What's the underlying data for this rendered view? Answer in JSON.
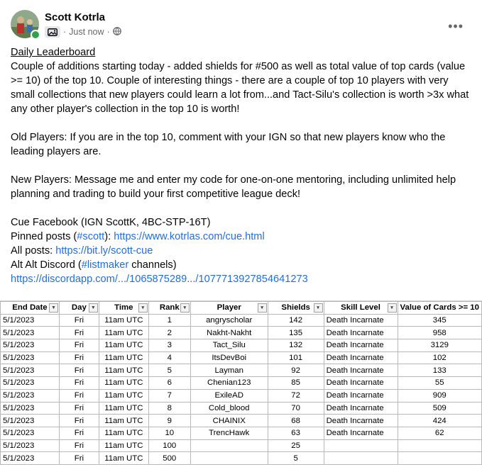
{
  "post": {
    "author": "Scott Kotrla",
    "timestamp": "Just now",
    "separator": "·",
    "audience_icon": "globe-icon",
    "badge_icon": "image-icon",
    "more_icon": "more-options-icon",
    "more_label": "•••"
  },
  "body": {
    "heading": "Daily Leaderboard",
    "para1": "Couple of additions starting today - added shields for #500 as well as total value of top cards (value >= 10) of the top 10. Couple of interesting things - there are a couple of top 10 players with very small collections that new players could learn a lot from...and Tact-Silu's collection is worth >3x what any other player's collection in the top 10 is worth!",
    "para2": "Old Players: If you are in the top 10, comment with your IGN so that new players know who the leading players are.",
    "para3": "New Players: Message me and enter my code for one-on-one mentoring, including unlimited help planning and trading to build your first competitive league deck!",
    "line_cue_facebook": "Cue Facebook (IGN ScottK, 4BC-STP-16T)",
    "pinned_prefix": "Pinned posts (",
    "pinned_hashtag": "#scott",
    "pinned_mid": "): ",
    "pinned_link": "https://www.kotrlas.com/cue.html",
    "all_prefix": "All posts: ",
    "all_link": "https://bit.ly/scott-cue",
    "discord_prefix": "Alt Alt Discord (",
    "discord_hashtag": "#listmaker",
    "discord_suffix": " channels)",
    "discord_link": "https://discordapp.com/.../1065875289.../1077713927854641273"
  },
  "table": {
    "columns": [
      "End Date",
      "Day",
      "Time",
      "Rank",
      "Player",
      "Shields",
      "Skill Level",
      "Value of Cards >= 10"
    ],
    "filter_applied": [
      true,
      true,
      false,
      false,
      false,
      false,
      false,
      false
    ],
    "rows": [
      [
        "5/1/2023",
        "Fri",
        "11am UTC",
        "1",
        "angryscholar",
        "142",
        "Death Incarnate",
        "345"
      ],
      [
        "5/1/2023",
        "Fri",
        "11am UTC",
        "2",
        "Nakht-Nakht",
        "135",
        "Death Incarnate",
        "958"
      ],
      [
        "5/1/2023",
        "Fri",
        "11am UTC",
        "3",
        "Tact_Silu",
        "132",
        "Death Incarnate",
        "3129"
      ],
      [
        "5/1/2023",
        "Fri",
        "11am UTC",
        "4",
        "ItsDevBoi",
        "101",
        "Death Incarnate",
        "102"
      ],
      [
        "5/1/2023",
        "Fri",
        "11am UTC",
        "5",
        "Layman",
        "92",
        "Death Incarnate",
        "133"
      ],
      [
        "5/1/2023",
        "Fri",
        "11am UTC",
        "6",
        "Chenian123",
        "85",
        "Death Incarnate",
        "55"
      ],
      [
        "5/1/2023",
        "Fri",
        "11am UTC",
        "7",
        "ExileAD",
        "72",
        "Death Incarnate",
        "909"
      ],
      [
        "5/1/2023",
        "Fri",
        "11am UTC",
        "8",
        "Cold_blood",
        "70",
        "Death Incarnate",
        "509"
      ],
      [
        "5/1/2023",
        "Fri",
        "11am UTC",
        "9",
        "CHAINIX",
        "68",
        "Death Incarnate",
        "424"
      ],
      [
        "5/1/2023",
        "Fri",
        "11am UTC",
        "10",
        "TrencHawk",
        "63",
        "Death Incarnate",
        "62"
      ],
      [
        "5/1/2023",
        "Fri",
        "11am UTC",
        "100",
        "",
        "25",
        "",
        ""
      ],
      [
        "5/1/2023",
        "Fri",
        "11am UTC",
        "500",
        "",
        "5",
        "",
        ""
      ]
    ]
  },
  "colors": {
    "link": "#216fdb",
    "online": "#31a24c",
    "muted_text": "#65676b",
    "grid_line": "#b8b8b8"
  }
}
